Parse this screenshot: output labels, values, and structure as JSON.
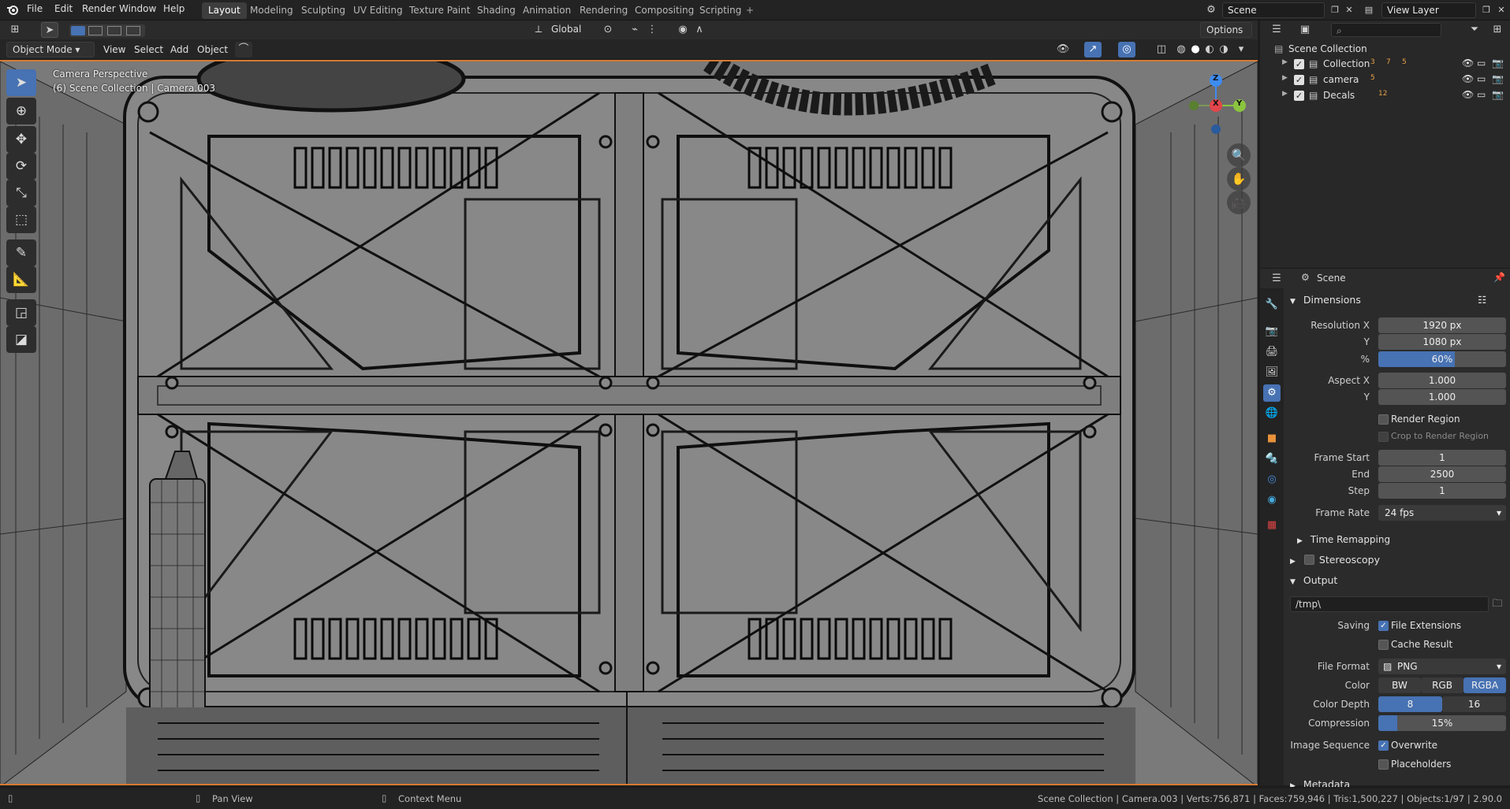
{
  "menu": {
    "file": "File",
    "edit": "Edit",
    "render": "Render",
    "window": "Window",
    "help": "Help"
  },
  "workspaces": [
    "Layout",
    "Modeling",
    "Sculpting",
    "UV Editing",
    "Texture Paint",
    "Shading",
    "Animation",
    "Rendering",
    "Compositing",
    "Scripting"
  ],
  "add_workspace": "+",
  "scene_field": "Scene",
  "view_layer_field": "View Layer",
  "header": {
    "mode": "Object Mode",
    "view": "View",
    "select": "Select",
    "add": "Add",
    "object": "Object",
    "transform_orientation": "Global",
    "options": "Options"
  },
  "viewport": {
    "perspective": "Camera Perspective",
    "collection_info": "(6) Scene Collection | Camera.003"
  },
  "gizmo": {
    "z": "Z",
    "x": "X",
    "y": "Y"
  },
  "outliner": {
    "root": "Scene Collection",
    "items": [
      {
        "name": "Collection",
        "counts": [
          "3",
          "7",
          "5"
        ]
      },
      {
        "name": "camera",
        "counts": [
          "5"
        ]
      },
      {
        "name": "Decals",
        "counts": [
          "12"
        ]
      }
    ]
  },
  "properties": {
    "context": "Scene",
    "dimensions": {
      "title": "Dimensions",
      "resolution_x_label": "Resolution X",
      "resolution_x": "1920 px",
      "y_label": "Y",
      "resolution_y": "1080 px",
      "percent_label": "%",
      "percent": "60%",
      "percent_value": 0.6,
      "aspect_x_label": "Aspect X",
      "aspect_x": "1.000",
      "aspect_y_label": "Y",
      "aspect_y": "1.000",
      "render_region": "Render Region",
      "crop_region": "Crop to Render Region",
      "frame_start_label": "Frame Start",
      "frame_start": "1",
      "end_label": "End",
      "frame_end": "2500",
      "step_label": "Step",
      "frame_step": "1",
      "frame_rate_label": "Frame Rate",
      "frame_rate": "24 fps",
      "time_remapping": "Time Remapping"
    },
    "stereoscopy": "Stereoscopy",
    "output": {
      "title": "Output",
      "path": "/tmp\\",
      "saving_label": "Saving",
      "file_extensions": "File Extensions",
      "cache_result": "Cache Result",
      "file_format_label": "File Format",
      "file_format": "PNG",
      "color_label": "Color",
      "color_options": [
        "BW",
        "RGB",
        "RGBA"
      ],
      "color_depth_label": "Color Depth",
      "color_depth_options": [
        "8",
        "16"
      ],
      "compression_label": "Compression",
      "compression": "15%",
      "compression_value": 0.15,
      "image_sequence_label": "Image Sequence",
      "overwrite": "Overwrite",
      "placeholders": "Placeholders"
    },
    "metadata": "Metadata"
  },
  "status": {
    "pan": "Pan View",
    "context_menu": "Context Menu",
    "stats": "Scene Collection | Camera.003 | Verts:756,871 | Faces:759,946 | Tris:1,500,227 | Objects:1/97 | 2.90.0"
  },
  "colors": {
    "accent": "#4772b3",
    "viewport_border": "#d57a33",
    "x_axis": "#e2454a",
    "y_axis": "#8bc53f",
    "z_axis": "#3d8cf0"
  }
}
